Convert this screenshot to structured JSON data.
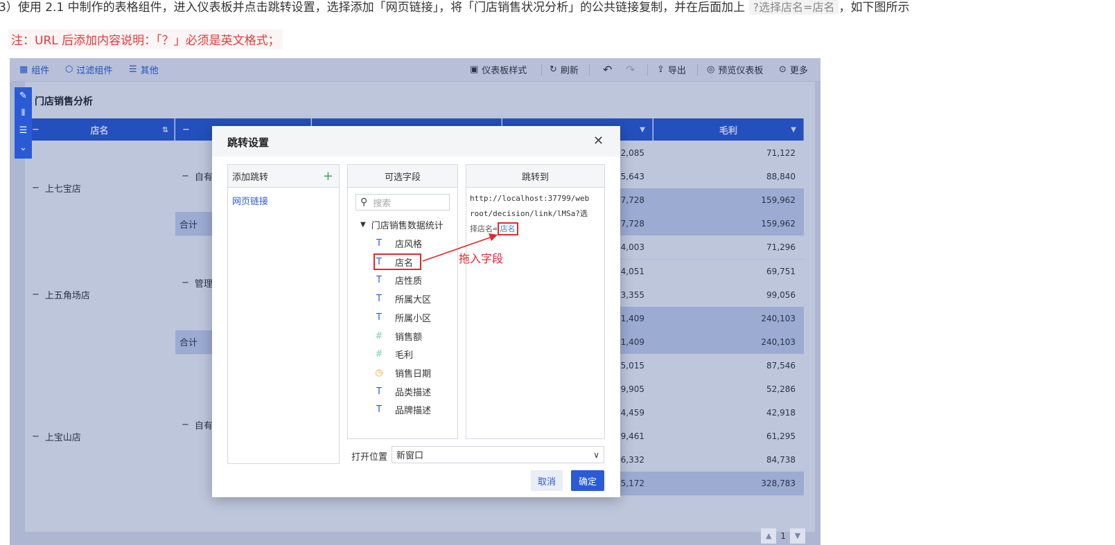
{
  "doc": {
    "line1_pre": "3）使用 2.1 中制作的表格组件，进入仪表板并点击跳转设置，选择添加「网页链接」，将「门店销售状况分析」的公共链接复制，并在后面加上",
    "line1_code": "?选择店名=店名",
    "line1_post": "，如下图所示",
    "note": "注：URL 后添加内容说明：「？」必须是英文格式；"
  },
  "toolbar": {
    "left": [
      "组件",
      "过滤组件",
      "其他"
    ],
    "right": [
      "仪表板样式",
      "刷新",
      "导出",
      "预览仪表板",
      "更多"
    ]
  },
  "widget": {
    "title": "门店销售分析"
  },
  "table": {
    "headers": {
      "store": "店名",
      "profit": "毛利"
    },
    "stores": [
      "上七宝店",
      "上五角场店",
      "上宝山店"
    ],
    "sub_labels": [
      "自有",
      "管理",
      "自有"
    ],
    "subtotal": "合计",
    "sales_col": [
      "572,085",
      "395,643",
      "567,728",
      "567,728",
      "534,003",
      "584,051",
      "943,355",
      "161,409",
      "161,409",
      "725,015",
      "479,905",
      "374,459",
      "719,461",
      "926,332",
      "225,172"
    ],
    "profit_col": [
      "71,122",
      "88,840",
      "159,962",
      "159,962",
      "71,296",
      "69,751",
      "99,056",
      "240,103",
      "240,103",
      "87,546",
      "52,286",
      "42,918",
      "61,295",
      "84,738",
      "328,783"
    ],
    "page": "1"
  },
  "dialog": {
    "title": "跳转设置",
    "add_jump": "添加跳转",
    "jump_item": "网页链接",
    "fields_title": "可选字段",
    "search_placeholder": "搜索",
    "group": "门店销售数据统计",
    "fields": [
      {
        "name": "店风格",
        "type": "text"
      },
      {
        "name": "店名",
        "type": "text"
      },
      {
        "name": "店性质",
        "type": "text"
      },
      {
        "name": "所属大区",
        "type": "text"
      },
      {
        "name": "所属小区",
        "type": "text"
      },
      {
        "name": "销售额",
        "type": "number"
      },
      {
        "name": "毛利",
        "type": "number"
      },
      {
        "name": "销售日期",
        "type": "date"
      },
      {
        "name": "品类描述",
        "type": "text"
      },
      {
        "name": "品牌描述",
        "type": "text"
      }
    ],
    "target_title": "跳转到",
    "url_line1": "http://localhost:37799/web",
    "url_line2": "root/decision/link/lMSa?选",
    "url_line3": "择店名=",
    "url_param": "店名",
    "annotation": "拖入字段",
    "open_label": "打开位置",
    "open_value": "新窗口",
    "cancel": "取消",
    "ok": "确定"
  },
  "colors": {
    "accent": "#2a5bd7",
    "annotation": "#e5262b"
  }
}
